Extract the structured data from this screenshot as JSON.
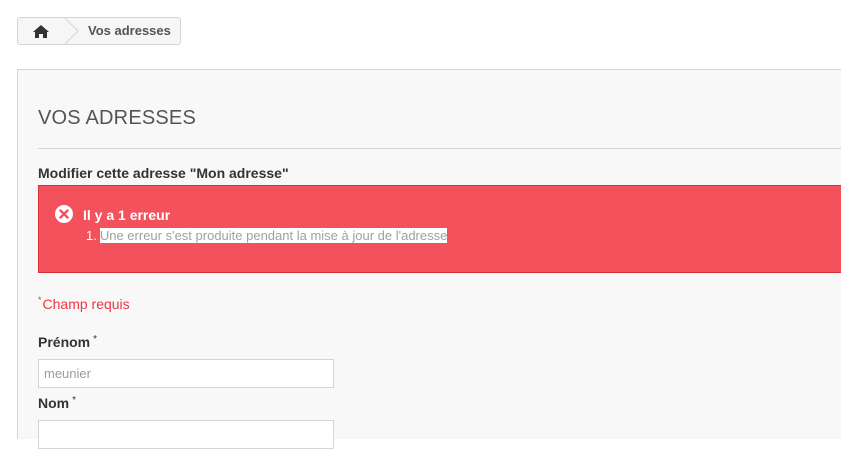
{
  "breadcrumb": {
    "home_icon": "home-icon",
    "current": "Vos adresses"
  },
  "page": {
    "title": "VOS ADRESSES",
    "subheading": "Modifier cette adresse \"Mon adresse\""
  },
  "alert": {
    "icon": "error-circle-icon",
    "title": "Il y a 1 erreur",
    "items": [
      {
        "number": "1.",
        "message": "Une erreur s'est produite pendant la mise à jour de l'adresse"
      }
    ],
    "color": "#f3515c"
  },
  "form": {
    "required_star": "*",
    "required_note": "Champ requis",
    "fields": [
      {
        "label": "Prénom",
        "star": "*",
        "value": "meunier"
      },
      {
        "label": "Nom",
        "star": "*",
        "value": ""
      }
    ]
  }
}
